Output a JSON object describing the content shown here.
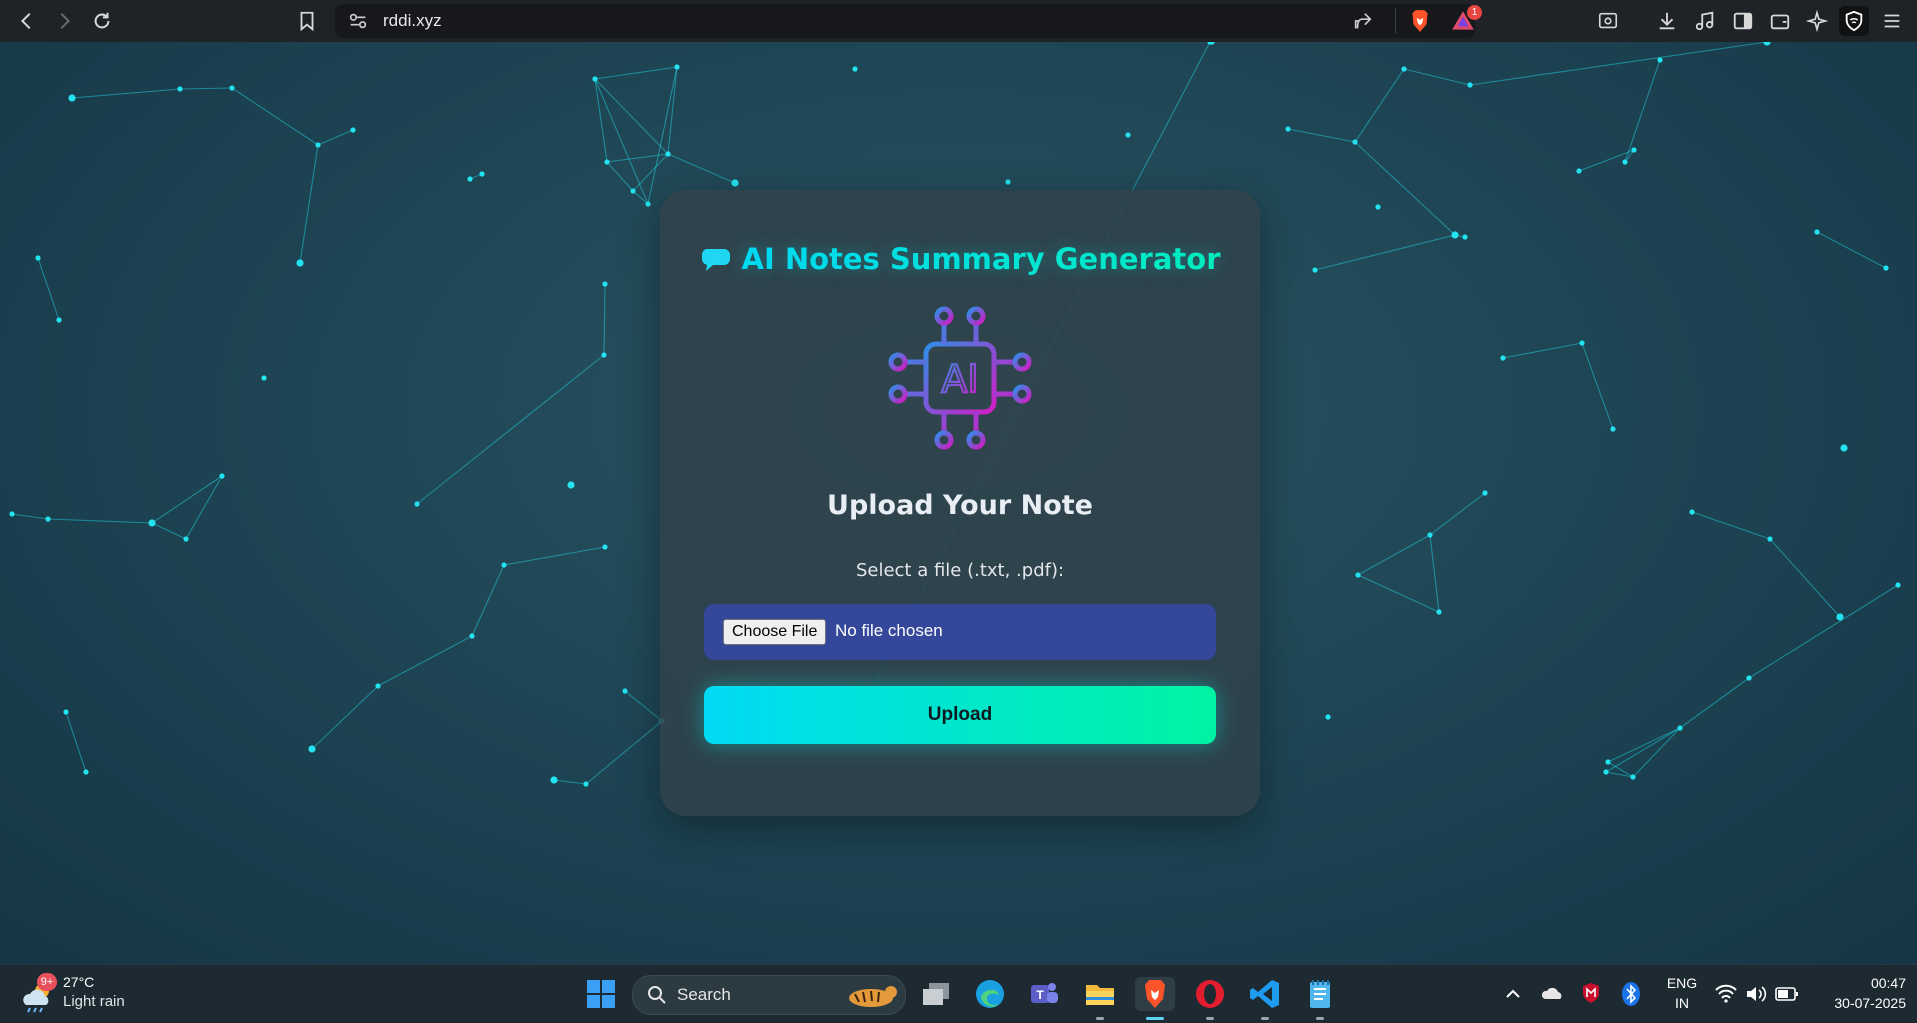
{
  "browser": {
    "url": "rddi.xyz",
    "notification_count": "1"
  },
  "card": {
    "title_icon": "speech-bubble-icon",
    "title": "AI Notes Summary Generator",
    "logo_text": "AI",
    "heading": "Upload Your Note",
    "select_label": "Select a file (.txt, .pdf):",
    "choose_file_label": "Choose File",
    "file_status": "No file chosen",
    "upload_label": "Upload"
  },
  "taskbar": {
    "weather_badge": "9+",
    "temperature": "27°C",
    "weather": "Light rain",
    "search_placeholder": "Search",
    "lang_line1": "ENG",
    "lang_line2": "IN",
    "time": "00:47",
    "date": "30-07-2025"
  },
  "colors": {
    "accent_start": "#00d4ff",
    "accent_end": "#00f0b5",
    "file_field_bg": "#35479b",
    "node": "#22e3ef"
  }
}
